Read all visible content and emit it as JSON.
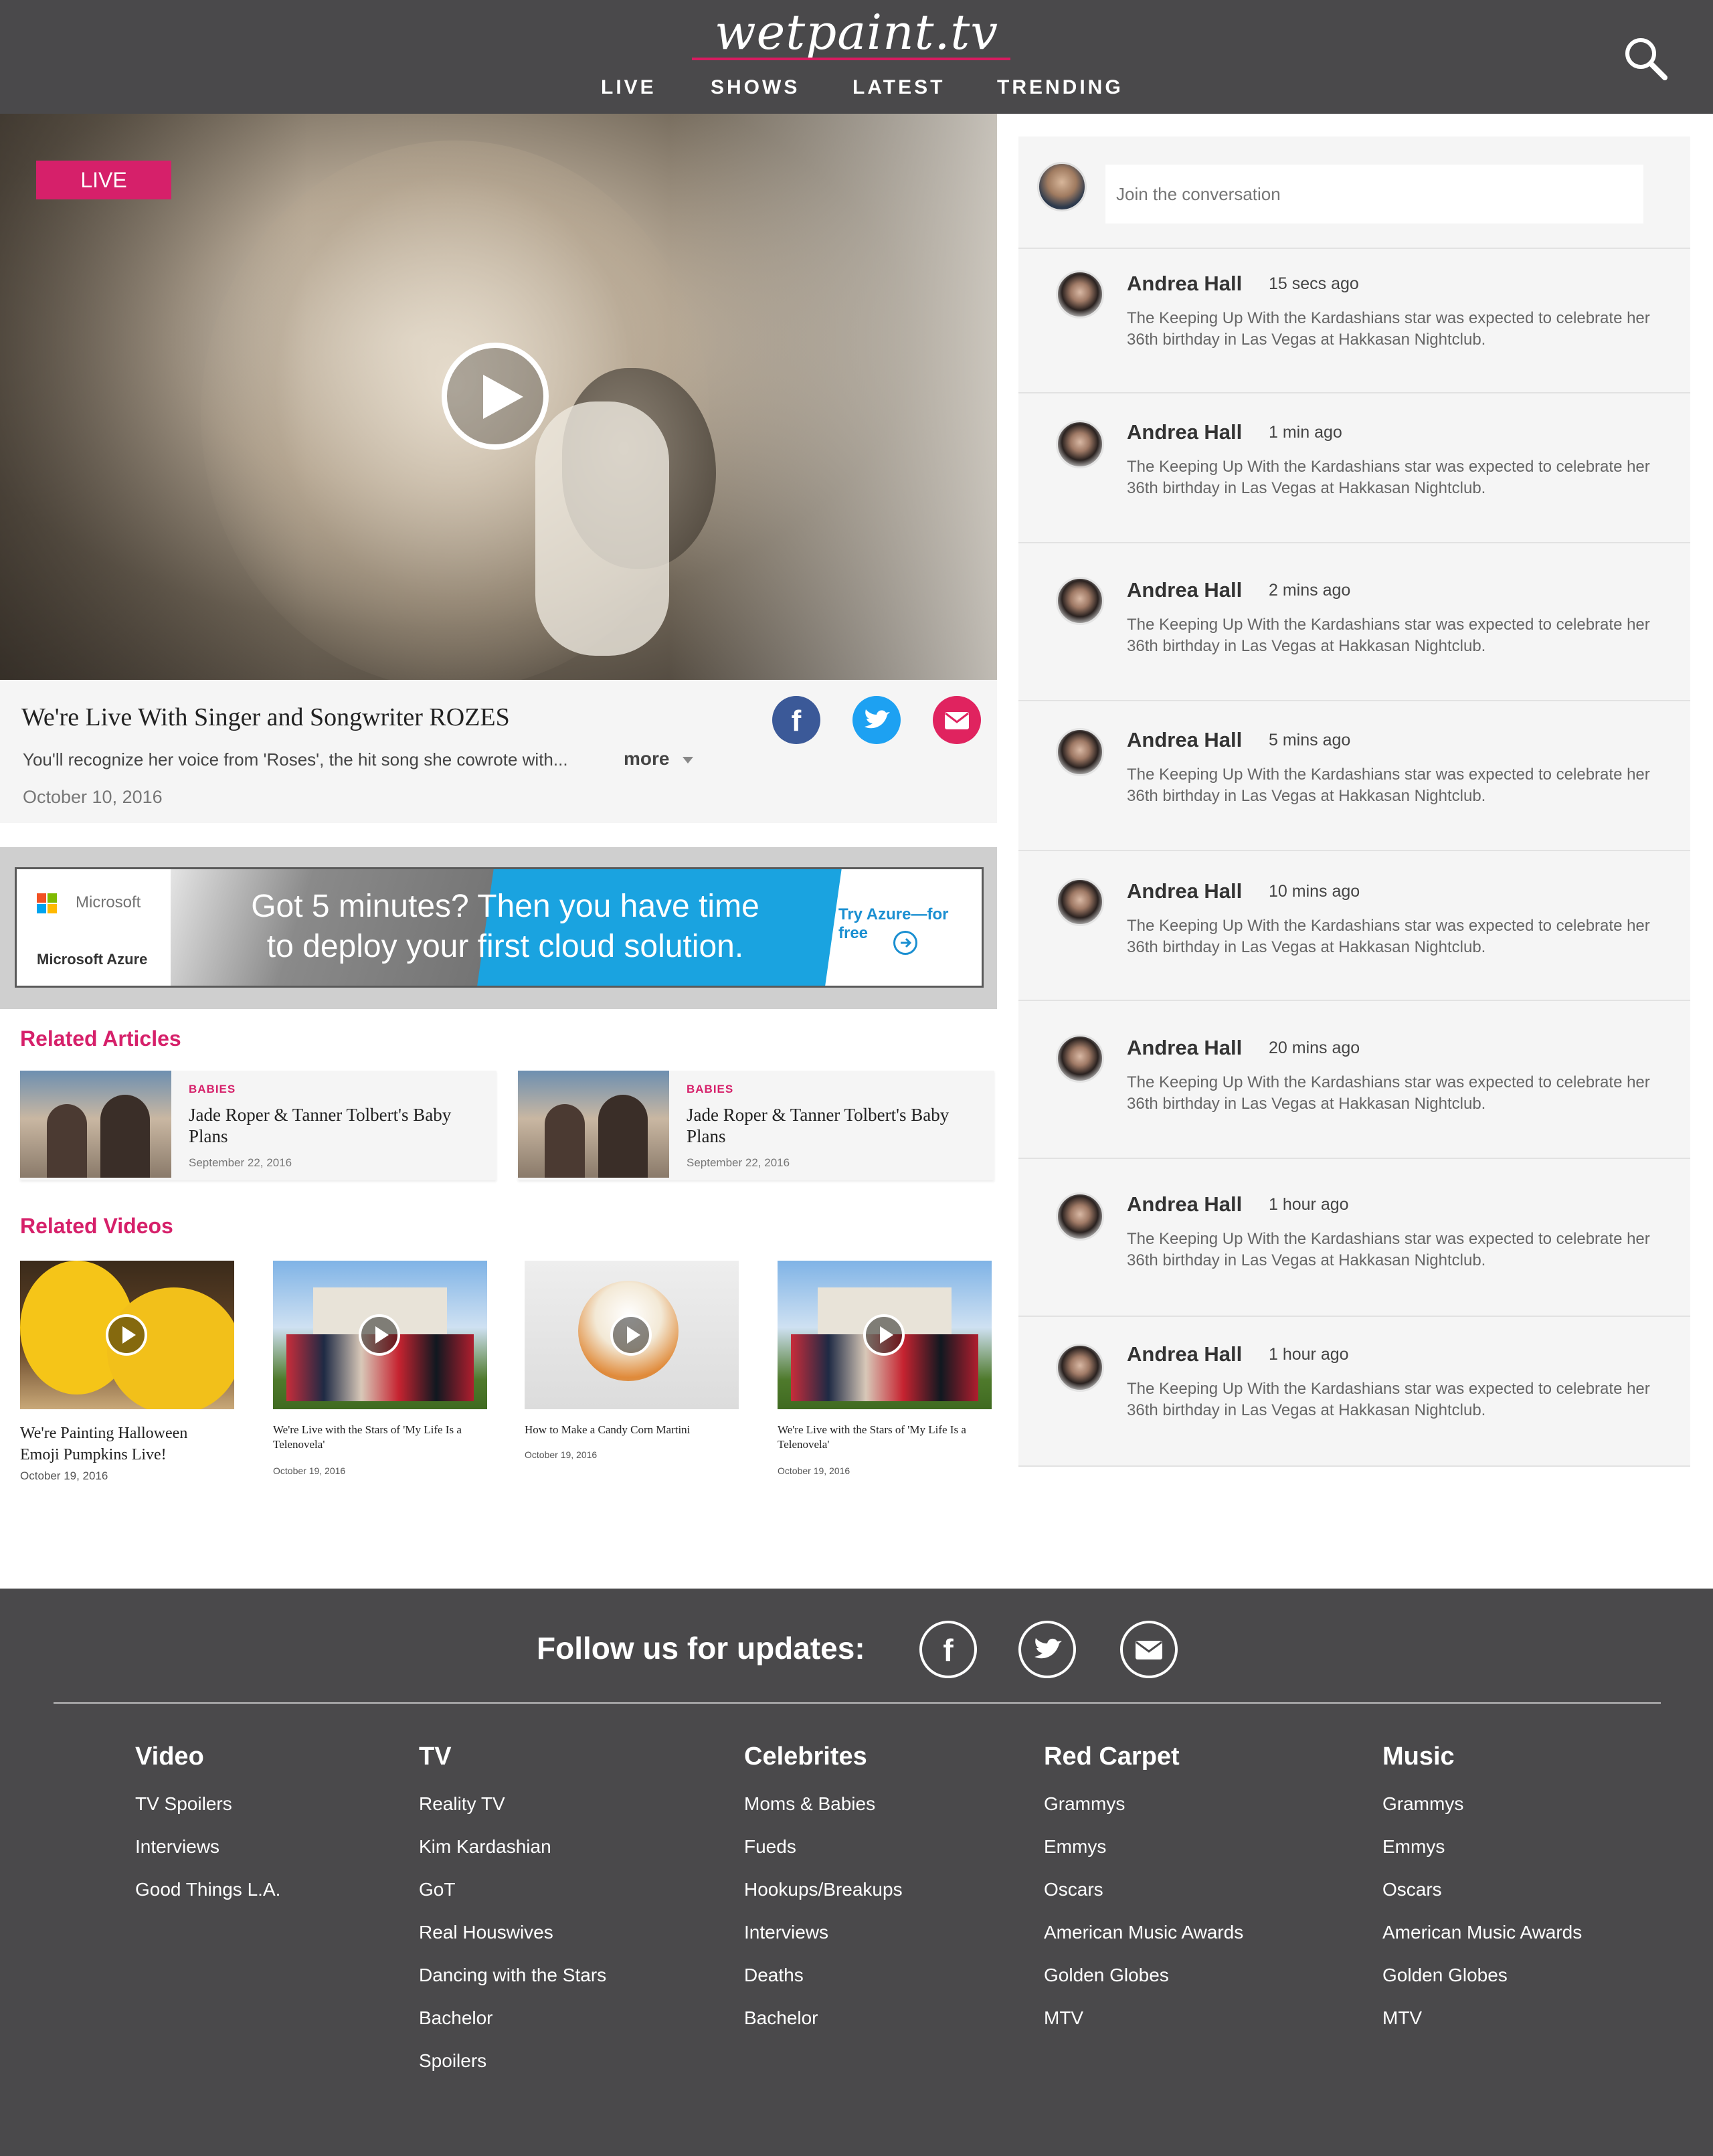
{
  "header": {
    "logo": "wetpaint.tv",
    "nav": [
      "LIVE",
      "SHOWS",
      "LATEST",
      "TRENDING"
    ],
    "search_icon": "search-icon"
  },
  "hero": {
    "badge": "LIVE",
    "play_icon": "play-icon"
  },
  "article": {
    "title": "We're Live With Singer and Songwriter ROZES",
    "description": "You'll recognize her voice from 'Roses', the hit song she cowrote with...",
    "more_label": "more",
    "date": "October 10, 2016",
    "share": [
      "facebook-icon",
      "twitter-icon",
      "email-icon"
    ],
    "colors": {
      "facebook": "#3b5998",
      "twitter": "#1da1f2",
      "email": "#e0235f"
    }
  },
  "ad": {
    "brand": "Microsoft",
    "product": "Microsoft Azure",
    "headline_line1": "Got 5 minutes? Then you have time",
    "headline_line2": "to deploy your first cloud solution.",
    "cta": "Try Azure—for free"
  },
  "related_articles": {
    "heading": "Related Articles",
    "items": [
      {
        "category": "BABIES",
        "title": "Jade Roper & Tanner Tolbert's Baby Plans",
        "date": "September 22, 2016"
      },
      {
        "category": "BABIES",
        "title": "Jade Roper & Tanner Tolbert's Baby Plans",
        "date": "September 22, 2016"
      }
    ]
  },
  "related_videos": {
    "heading": "Related Videos",
    "items": [
      {
        "title": "We're Painting Halloween Emoji Pumpkins Live!",
        "date": "October 19, 2016"
      },
      {
        "title": "We're Live with the Stars of 'My Life Is a Telenovela'",
        "date": "October 19, 2016"
      },
      {
        "title": "How to Make a Candy Corn Martini",
        "date": "October 19, 2016"
      },
      {
        "title": "We're Live with the Stars of 'My Life Is a Telenovela'",
        "date": "October 19, 2016"
      }
    ]
  },
  "conversation": {
    "placeholder": "Join the conversation",
    "comments": [
      {
        "name": "Andrea Hall",
        "time": "15 secs ago",
        "text": "The Keeping Up With the Kardashians star was expected to celebrate her 36th birthday in Las Vegas at Hakkasan Nightclub."
      },
      {
        "name": "Andrea Hall",
        "time": "1 min ago",
        "text": "The Keeping Up With the Kardashians star was expected to celebrate her 36th birthday in Las Vegas at Hakkasan Nightclub."
      },
      {
        "name": "Andrea Hall",
        "time": "2 mins ago",
        "text": "The Keeping Up With the Kardashians star was expected to celebrate her 36th birthday in Las Vegas at Hakkasan Nightclub."
      },
      {
        "name": "Andrea Hall",
        "time": "5 mins ago",
        "text": "The Keeping Up With the Kardashians star was expected to celebrate her 36th birthday in Las Vegas at Hakkasan Nightclub."
      },
      {
        "name": "Andrea Hall",
        "time": "10 mins ago",
        "text": "The Keeping Up With the Kardashians star was expected to celebrate her 36th birthday in Las Vegas at Hakkasan Nightclub."
      },
      {
        "name": "Andrea Hall",
        "time": "20 mins ago",
        "text": "The Keeping Up With the Kardashians star was expected to celebrate her 36th birthday in Las Vegas at Hakkasan Nightclub."
      },
      {
        "name": "Andrea Hall",
        "time": "1 hour ago",
        "text": "The Keeping Up With the Kardashians star was expected to celebrate her 36th birthday in Las Vegas at Hakkasan Nightclub."
      },
      {
        "name": "Andrea Hall",
        "time": "1 hour ago",
        "text": "The Keeping Up With the Kardashians star was expected to celebrate her 36th birthday in Las Vegas at Hakkasan Nightclub."
      }
    ]
  },
  "footer": {
    "follow_label": "Follow us for updates:",
    "follow_icons": [
      "facebook-icon",
      "twitter-icon",
      "email-icon"
    ],
    "columns": [
      {
        "heading": "Video",
        "links": [
          "TV Spoilers",
          "Interviews",
          "Good Things L.A."
        ]
      },
      {
        "heading": "TV",
        "links": [
          "Reality TV",
          "Kim Kardashian",
          "GoT",
          "Real Houswives",
          "Dancing with the Stars",
          "Bachelor",
          "Spoilers"
        ]
      },
      {
        "heading": "Celebrites",
        "links": [
          "Moms & Babies",
          "Fueds",
          "Hookups/Breakups",
          "Interviews",
          "Deaths",
          "Bachelor"
        ]
      },
      {
        "heading": "Red Carpet",
        "links": [
          "Grammys",
          "Emmys",
          "Oscars",
          "American Music Awards",
          "Golden Globes",
          "MTV"
        ]
      },
      {
        "heading": "Music",
        "links": [
          "Grammys",
          "Emmys",
          "Oscars",
          "American Music Awards",
          "Golden Globes",
          "MTV"
        ]
      }
    ]
  },
  "colors": {
    "accent": "#d6206a",
    "header_bg": "#4a494b",
    "panel_bg": "#f5f5f5"
  }
}
